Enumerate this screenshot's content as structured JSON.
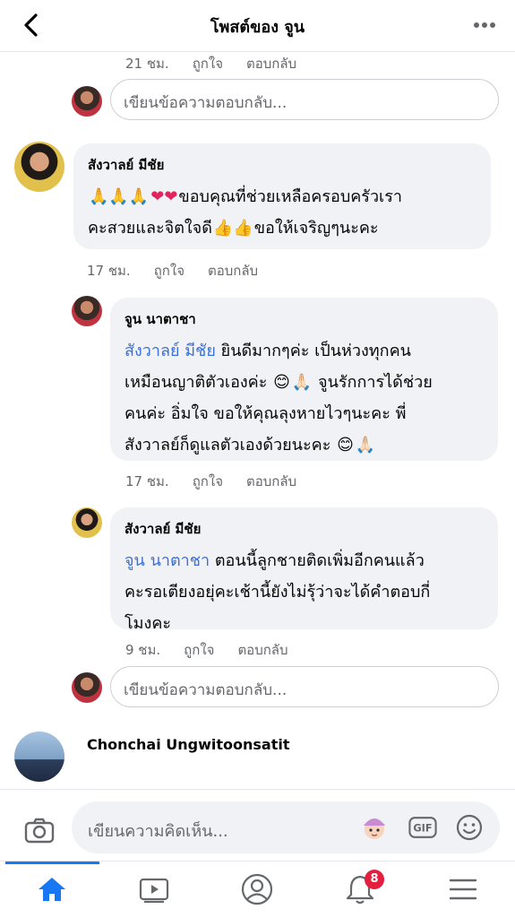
{
  "header": {
    "title": "โพสต์ของ จูน"
  },
  "top_meta": {
    "time": "21 ชม.",
    "like": "ถูกใจ",
    "reply": "ตอบกลับ"
  },
  "reply_placeholder": "เขียนข้อความตอบกลับ...",
  "comment1": {
    "author": "สังวาลย์ มีชัย",
    "line1": "ขอบคุณที่ช่วยเหลือครอบครัวเรา",
    "line2a": "คะสวยและจิตใจดี",
    "line2b": "ขอให้เจริญๆนะคะ",
    "time": "17 ชม.",
    "like": "ถูกใจ",
    "reply": "ตอบกลับ"
  },
  "reply1": {
    "author": "จูน นาตาชา",
    "mention": "สังวาลย์ มีชัย",
    "line1": "  ยินดีมากๆค่ะ  เป็นห่วงทุกคน",
    "line2a": "เหมือนญาติตัวเองค่ะ ",
    "line2b": " จูนรักการได้ช่วย",
    "line3": "คนค่ะ อิ่มใจ ขอให้คุณลุงหายไวๆนะคะ พี่",
    "line4": "สังวาลย์ก็ดูแลตัวเองด้วยนะคะ ",
    "time": "17 ชม.",
    "like": "ถูกใจ",
    "reply": "ตอบกลับ"
  },
  "reply2": {
    "author": "สังวาลย์ มีชัย",
    "mention": "จูน นาตาชา",
    "line1": " ตอนนี้ลูกชายติดเพิ่มอีกคนแล้ว",
    "line2": "คะรอเตียงอยุ่คะเช้านี้ยังไม่รุ้ว่าจะได้คำตอบกี่",
    "line3": "โมงคะ",
    "time": "9 ชม.",
    "like": "ถูกใจ",
    "reply": "ตอบกลับ"
  },
  "comment2": {
    "author": "Chonchai Ungwitoonsatit"
  },
  "composer": {
    "placeholder": "เขียนความคิดเห็น...",
    "gif_label": "GIF"
  },
  "navbar": {
    "notification_count": "8"
  },
  "colors": {
    "accent": "#1877f2",
    "mention": "#3a6fd8",
    "badge": "#e41e3f",
    "bubble": "#f0f2f5"
  }
}
